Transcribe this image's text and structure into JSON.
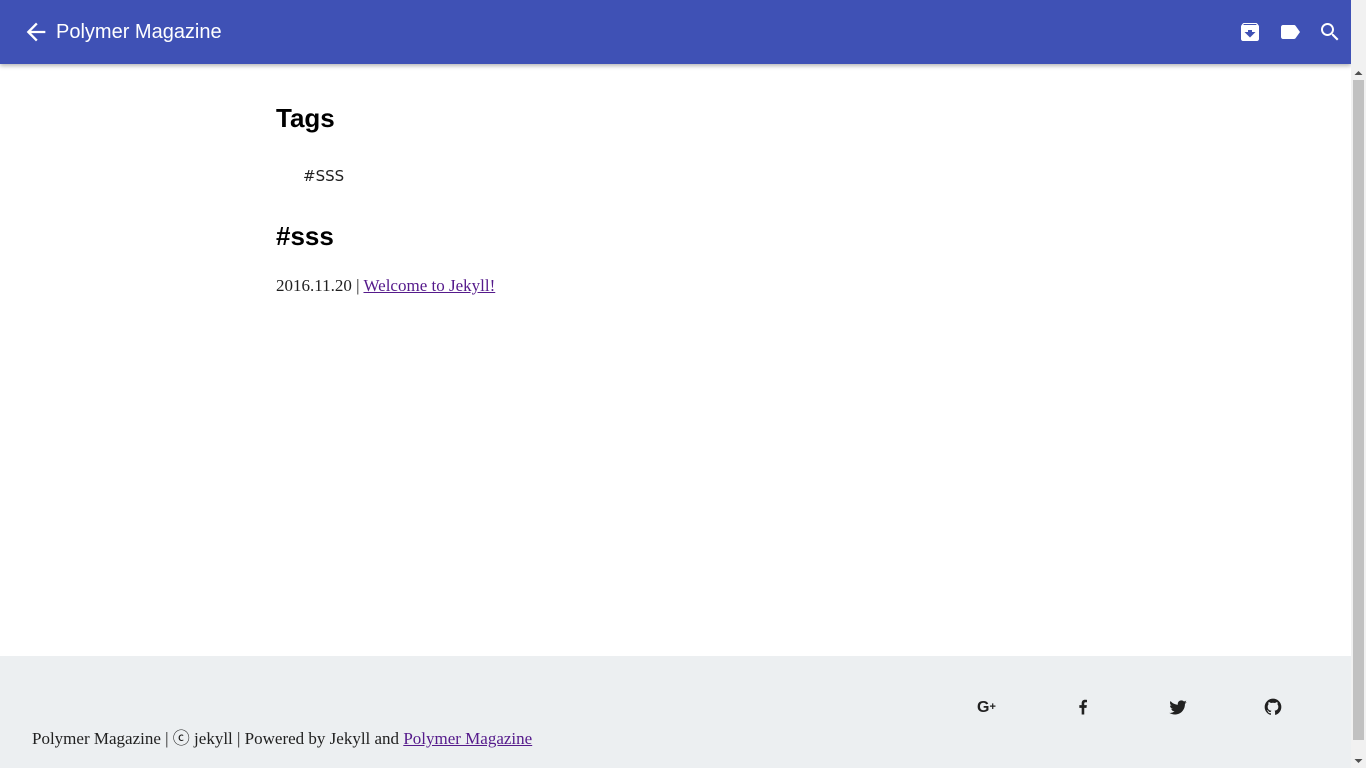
{
  "appbar": {
    "title": "Polymer Magazine",
    "color": "#3f51b5",
    "back_icon": "arrow-back-icon",
    "actions": [
      {
        "name": "archive-icon"
      },
      {
        "name": "label-icon"
      },
      {
        "name": "search-icon"
      }
    ]
  },
  "tags_section": {
    "heading": "Tags",
    "tags": [
      {
        "label": "#SSS"
      }
    ]
  },
  "tag_section": {
    "heading": "#sss",
    "posts": [
      {
        "date": "2016.11.20",
        "separator": "|",
        "title": "Welcome to Jekyll!"
      }
    ]
  },
  "footer": {
    "site_name": "Polymer Magazine",
    "copyright": "ⓒ jekyll",
    "powered_by": "Powered by Jekyll and",
    "theme_link": "Polymer Magazine",
    "separator": "|",
    "background": "#eceff1",
    "social": [
      {
        "name": "google-plus-icon"
      },
      {
        "name": "facebook-icon"
      },
      {
        "name": "twitter-icon"
      },
      {
        "name": "github-icon"
      }
    ]
  }
}
